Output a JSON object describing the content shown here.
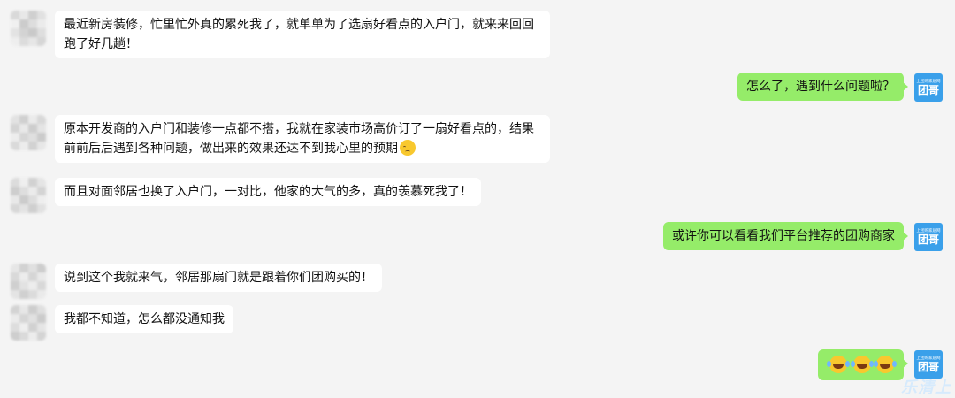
{
  "messages": [
    {
      "side": "incoming",
      "text": "最近新房装修，忙里忙外真的累死我了，就单单为了选扇好看点的入户门，就来来回回跑了好几趟！"
    },
    {
      "side": "outgoing",
      "text": "怎么了，遇到什么问题啦？",
      "avatar": {
        "small": "上团购家居网",
        "big": "团哥"
      }
    },
    {
      "side": "incoming",
      "text": "原本开发商的入户门和装修一点都不搭，我就在家装市场高价订了一扇好看点的，结果前前后后遇到各种问题，做出来的效果还达不到我心里的预期",
      "emoji": "pensive-face-icon"
    },
    {
      "side": "incoming",
      "text": "而且对面邻居也换了入户门，一对比，他家的大气的多，真的羡慕死我了！"
    },
    {
      "side": "outgoing",
      "text": "或许你可以看看我们平台推荐的团购商家",
      "avatar": {
        "small": "上团购家居网",
        "big": "团哥"
      }
    },
    {
      "side": "incoming",
      "text": "说到这个我就来气，邻居那扇门就是跟着你们团购买的！"
    },
    {
      "side": "incoming",
      "text": "我都不知道，怎么都没通知我"
    },
    {
      "side": "outgoing",
      "text": "",
      "emojis": [
        "tears-of-joy-icon",
        "tears-of-joy-icon",
        "tears-of-joy-icon"
      ],
      "avatar": {
        "small": "上团购家居网",
        "big": "团哥"
      }
    }
  ],
  "watermark": "乐清上"
}
